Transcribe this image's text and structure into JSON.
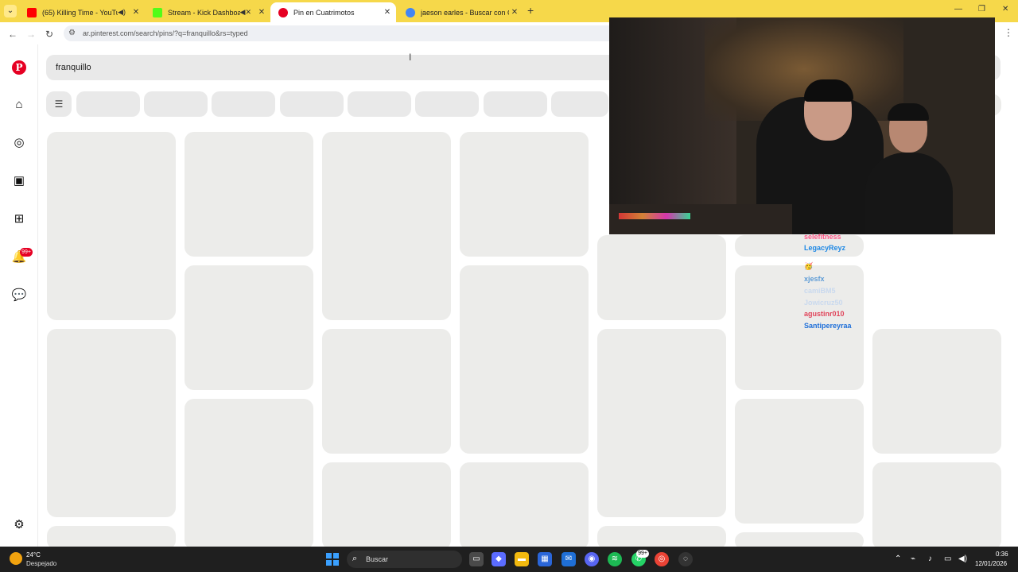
{
  "browser": {
    "tabs": [
      {
        "title": "(65) Killing Time - YouTube",
        "favicon": "youtube-icon",
        "color": "#ff0000",
        "audio": "speaker-icon"
      },
      {
        "title": "Stream - Kick Dashboard",
        "favicon": "kick-icon",
        "color": "#53fc18",
        "audio": "muted-speaker-icon"
      },
      {
        "title": "Pin en Cuatrimotos",
        "favicon": "pinterest-icon",
        "color": "#e60023",
        "active": true
      },
      {
        "title": "jaeson earles - Buscar con Goo",
        "favicon": "google-icon",
        "color": "#4285f4"
      }
    ],
    "url": "ar.pinterest.com/search/pins/?q=franquillo&rs=typed",
    "tabbar_color": "#f6d84a"
  },
  "pinterest": {
    "search_query": "franquillo",
    "notification_count": "99+",
    "brand_color": "#e60023"
  },
  "chat": [
    {
      "user": "selefitness",
      "color": "#ff5a8a"
    },
    {
      "user": "LegacyReyz",
      "color": "#1e88e5"
    },
    {
      "user": "🥳",
      "color": "#333333"
    },
    {
      "user": "xjesfx",
      "color": "#5c9bd6"
    },
    {
      "user": "camiBM5",
      "color": "#c9d9ee"
    },
    {
      "user": "Jowicruz50",
      "color": "#c9d9ee"
    },
    {
      "user": "agustinr010",
      "color": "#e0445a"
    },
    {
      "user": "Santipereyraa",
      "color": "#1e6fd9"
    }
  ],
  "taskbar": {
    "weather_temp": "24°C",
    "weather_desc": "Despejado",
    "search_label": "Buscar",
    "whatsapp_badge": "99+",
    "time": "0:36",
    "date": "12/01/2026"
  }
}
